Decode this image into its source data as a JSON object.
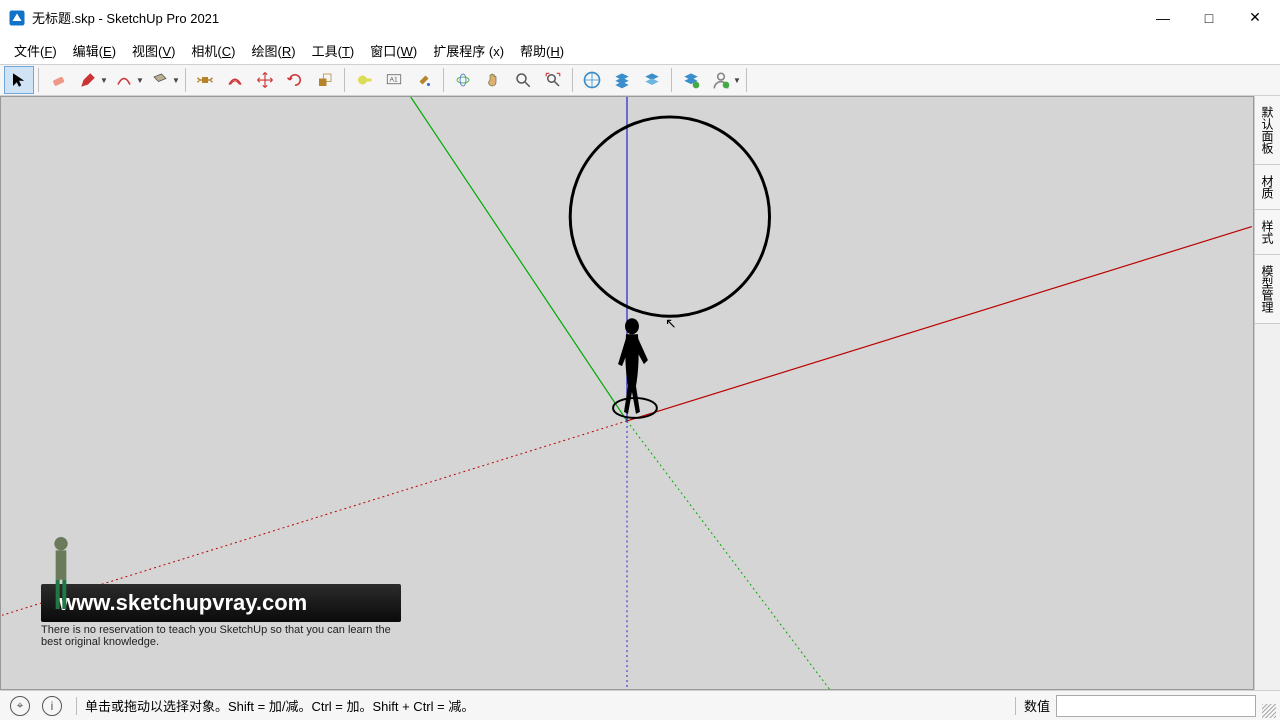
{
  "window": {
    "title": "无标题.skp - SketchUp Pro 2021",
    "min": "—",
    "max": "□",
    "close": "✕"
  },
  "menu": {
    "file": {
      "label": "文件",
      "accel": "F"
    },
    "edit": {
      "label": "编辑",
      "accel": "E"
    },
    "view": {
      "label": "视图",
      "accel": "V"
    },
    "camera": {
      "label": "相机",
      "accel": "C"
    },
    "draw": {
      "label": "绘图",
      "accel": "R"
    },
    "tools": {
      "label": "工具",
      "accel": "T"
    },
    "window": {
      "label": "窗口",
      "accel": "W"
    },
    "ext": {
      "label": "扩展程序",
      "accel_raw": " (x)"
    },
    "help": {
      "label": "帮助",
      "accel": "H"
    }
  },
  "toolbar_icons": [
    "select-icon",
    "eraser-icon",
    "pencil-icon",
    "arc-icon",
    "rectangle-icon",
    "pushpull-icon",
    "offset-icon",
    "move-icon",
    "rotate-icon",
    "scale-icon",
    "tape-icon",
    "text-icon",
    "paint-icon",
    "orbit-icon",
    "pan-icon",
    "zoom-icon",
    "zoom-extents-icon",
    "vray-icon",
    "vray-b-icon",
    "vray-c-icon",
    "vray-d-icon",
    "vray-user-icon"
  ],
  "rail": {
    "tabs": [
      "默认面板",
      "材质",
      "样式",
      "模型管理"
    ]
  },
  "status": {
    "hint": "单击或拖动以选择对象。Shift = 加/减。Ctrl = 加。Shift + Ctrl = 减。",
    "value_label": "数值",
    "value": ""
  },
  "overlay": {
    "url": "www.sketchupvray.com",
    "sub": "There is no reservation to teach you SketchUp so that you can learn the best original knowledge."
  }
}
